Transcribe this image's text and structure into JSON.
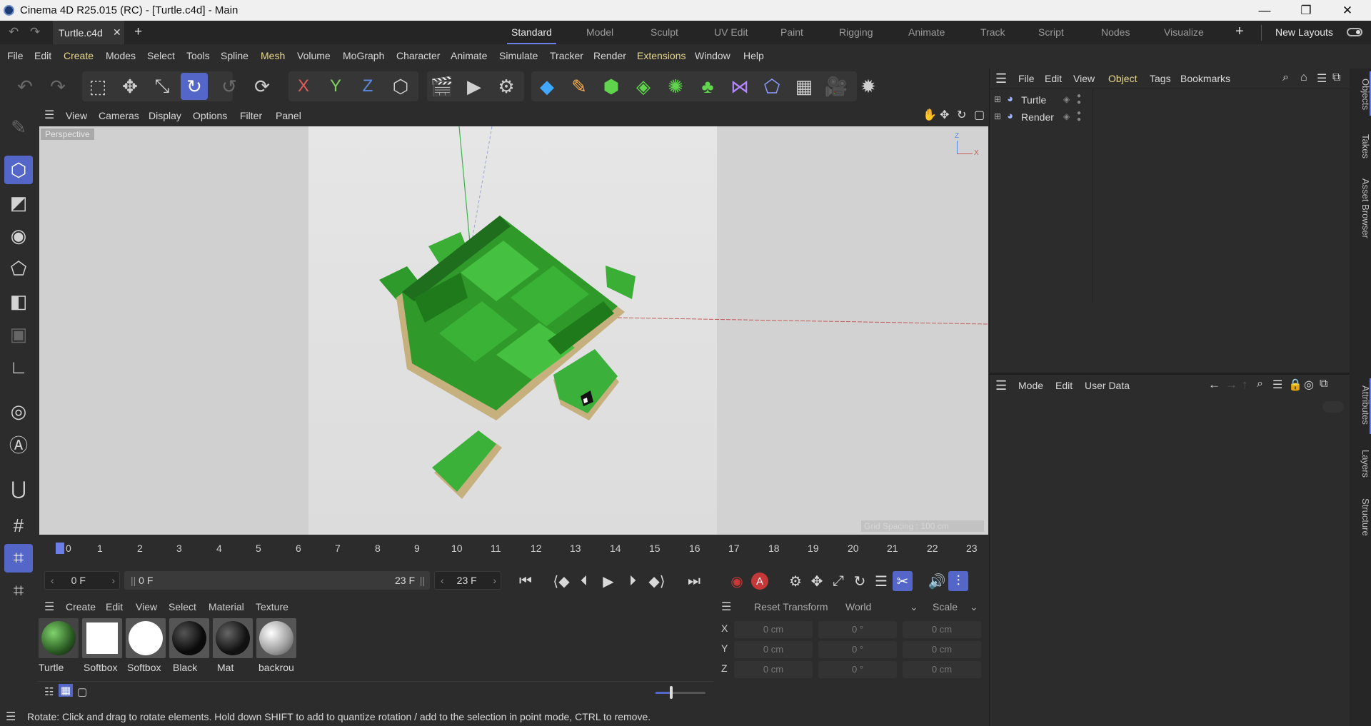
{
  "window": {
    "title": "Cinema 4D R25.015 (RC) - [Turtle.c4d] - Main"
  },
  "tabs": {
    "document": "Turtle.c4d",
    "layouts": [
      "Standard",
      "Model",
      "Sculpt",
      "UV Edit",
      "Paint",
      "Rigging",
      "Animate",
      "Track",
      "Script",
      "Nodes",
      "Visualize"
    ],
    "active_layout": "Standard",
    "new_layouts": "New Layouts"
  },
  "menu": [
    "File",
    "Edit",
    "Create",
    "Modes",
    "Select",
    "Tools",
    "Spline",
    "Mesh",
    "Volume",
    "MoGraph",
    "Character",
    "Animate",
    "Simulate",
    "Tracker",
    "Render",
    "Extensions",
    "Window",
    "Help"
  ],
  "toolbar_axes": {
    "x": "X",
    "y": "Y",
    "z": "Z"
  },
  "viewport": {
    "menu": [
      "View",
      "Cameras",
      "Display",
      "Options",
      "Filter",
      "Panel"
    ],
    "camera_label": "Perspective",
    "axis_z": "Z",
    "axis_x": "X",
    "grid_label": "Grid Spacing : 100 cm"
  },
  "timeline": {
    "ticks": [
      "0",
      "1",
      "2",
      "3",
      "4",
      "5",
      "6",
      "7",
      "8",
      "9",
      "10",
      "11",
      "12",
      "13",
      "14",
      "15",
      "16",
      "17",
      "18",
      "19",
      "20",
      "21",
      "22",
      "23"
    ],
    "current_frame": "0 F",
    "range_start": "0 F",
    "range_end": "23 F",
    "end_frame": "23 F"
  },
  "materials": {
    "menu": [
      "Create",
      "Edit",
      "View",
      "Select",
      "Material",
      "Texture"
    ],
    "items": [
      {
        "name": "Turtle",
        "color": "#3a6b2a"
      },
      {
        "name": "Softbox",
        "color": "#ffffff"
      },
      {
        "name": "Softbox",
        "color": "#f4f4f4"
      },
      {
        "name": "Black",
        "color": "#111111"
      },
      {
        "name": "Mat",
        "color": "#1c1c1c"
      },
      {
        "name": "backrou",
        "color": "#d8d8d8"
      }
    ]
  },
  "coordinates": {
    "reset": "Reset Transform",
    "space": "World",
    "mode": "Scale",
    "rows": [
      {
        "axis": "X",
        "pos": "0 cm",
        "rot": "0 °",
        "scale": "0 cm"
      },
      {
        "axis": "Y",
        "pos": "0 cm",
        "rot": "0 °",
        "scale": "0 cm"
      },
      {
        "axis": "Z",
        "pos": "0 cm",
        "rot": "0 °",
        "scale": "0 cm"
      }
    ]
  },
  "objects": {
    "menu": [
      "File",
      "Edit",
      "View",
      "Object",
      "Tags",
      "Bookmarks"
    ],
    "active_menu": "Object",
    "items": [
      "Turtle",
      "Render"
    ]
  },
  "attributes": {
    "menu": [
      "Mode",
      "Edit",
      "User Data"
    ]
  },
  "side_tabs": [
    "Objects",
    "Takes",
    "Asset Browser",
    "Attributes",
    "Layers",
    "Structure"
  ],
  "status": "Rotate: Click and drag to rotate elements. Hold down SHIFT to add to quantize rotation / add to the selection in point mode, CTRL to remove.",
  "colors": {
    "accent": "#5467c9",
    "highlight_menu": "#e8d98b",
    "turtle_green": "#2f9a2a"
  }
}
